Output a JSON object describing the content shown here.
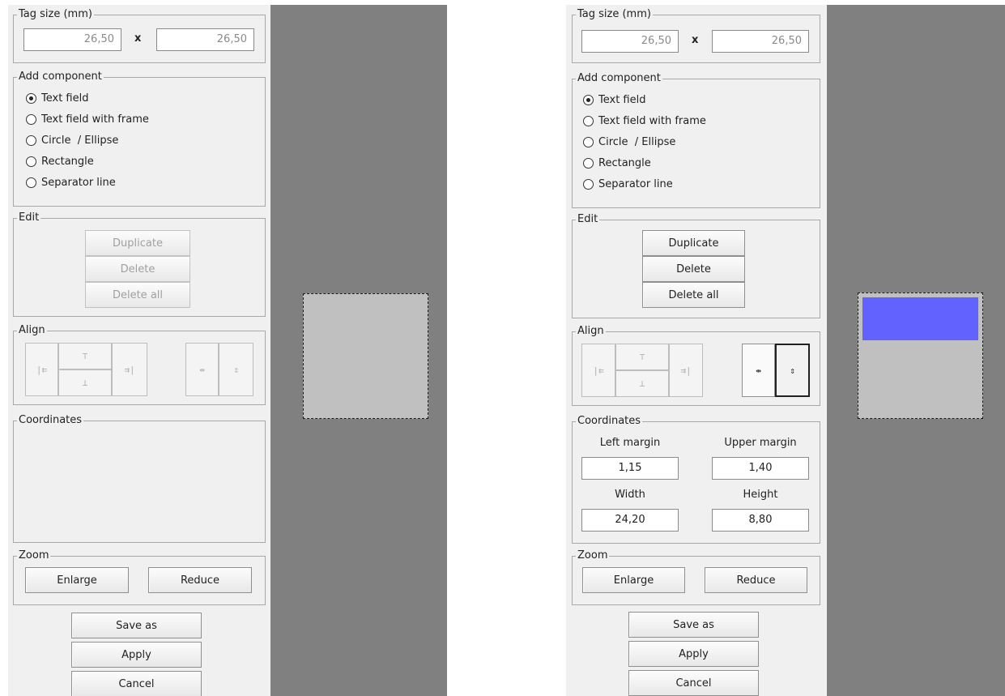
{
  "left": {
    "tag_size": {
      "label": "Tag size (mm)",
      "width": "26,50",
      "height": "26,50",
      "separator": "x"
    },
    "add_component": {
      "label": "Add component",
      "options": [
        "Text field",
        "Text field with frame",
        "Circle  / Ellipse",
        "Rectangle",
        "Separator line"
      ],
      "selected": 0
    },
    "edit": {
      "label": "Edit",
      "duplicate": "Duplicate",
      "delete": "Delete",
      "delete_all": "Delete all",
      "enabled": false
    },
    "align": {
      "label": "Align",
      "icons": [
        "align-left-icon",
        "align-top-icon",
        "align-bottom-icon",
        "align-right-icon",
        "center-horizontal-icon",
        "center-vertical-icon"
      ]
    },
    "coordinates": {
      "label": "Coordinates"
    },
    "zoom": {
      "label": "Zoom",
      "enlarge": "Enlarge",
      "reduce": "Reduce"
    },
    "actions": {
      "save_as": "Save as",
      "apply": "Apply",
      "cancel": "Cancel"
    }
  },
  "right": {
    "tag_size": {
      "label": "Tag size (mm)",
      "width": "26,50",
      "height": "26,50",
      "separator": "x"
    },
    "add_component": {
      "label": "Add component",
      "options": [
        "Text field",
        "Text field with frame",
        "Circle  / Ellipse",
        "Rectangle",
        "Separator line"
      ],
      "selected": 0
    },
    "edit": {
      "label": "Edit",
      "duplicate": "Duplicate",
      "delete": "Delete",
      "delete_all": "Delete all",
      "enabled": true
    },
    "align": {
      "label": "Align"
    },
    "coordinates": {
      "label": "Coordinates",
      "left_margin_label": "Left margin",
      "left_margin": "1,15",
      "upper_margin_label": "Upper margin",
      "upper_margin": "1,40",
      "width_label": "Width",
      "width": "24,20",
      "height_label": "Height",
      "height": "8,80"
    },
    "zoom": {
      "label": "Zoom",
      "enlarge": "Enlarge",
      "reduce": "Reduce"
    },
    "actions": {
      "save_as": "Save as",
      "apply": "Apply",
      "cancel": "Cancel"
    }
  },
  "colors": {
    "canvas_bg": "#808080",
    "tag_bg": "#c0c0c0",
    "selection_fill": "#6262ff",
    "panel_bg": "#f0f0f0"
  }
}
